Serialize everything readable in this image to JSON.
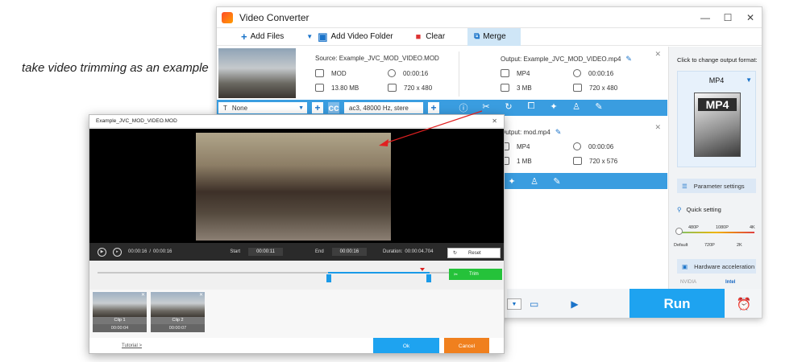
{
  "caption": "take video trimming as an example",
  "window": {
    "title": "Video Converter",
    "minimize_label": "—",
    "maximize_label": "☐",
    "close_label": "✕"
  },
  "toolbar": {
    "add_files": "Add Files",
    "add_video_folder": "Add Video Folder",
    "clear": "Clear",
    "merge": "Merge"
  },
  "file1": {
    "source": "Source: Example_JVC_MOD_VIDEO.MOD",
    "src_format": "MOD",
    "src_duration": "00:00:16",
    "src_size": "13.80 MB",
    "src_resolution": "720 x 480",
    "output": "Output: Example_JVC_MOD_VIDEO.mp4",
    "out_format": "MP4",
    "out_duration": "00:00:16",
    "out_size": "3 MB",
    "out_resolution": "720 x 480",
    "subtitle": "None",
    "audio": "ac3, 48000 Hz, stere"
  },
  "file2": {
    "output": "Output: mod.mp4",
    "out_format": "MP4",
    "out_duration": "00:00:06",
    "out_size": "1 MB",
    "out_resolution": "720 x 576"
  },
  "right_panel": {
    "change_format": "Click to change output format:",
    "format": "MP4",
    "format_icon_text": "MP4",
    "parameter_settings": "Parameter settings",
    "quick_setting": "Quick setting",
    "ticks_top": [
      "480P",
      "1080P",
      "4K"
    ],
    "ticks_bottom": [
      "Default",
      "720P",
      "2K"
    ],
    "hardware_acceleration": "Hardware acceleration",
    "nvidia": "NVIDIA",
    "intel": "Intel"
  },
  "run_label": "Run",
  "dialog": {
    "title": "Example_JVC_MOD_VIDEO.MOD",
    "current_time": "00:00:16",
    "separator": "/",
    "total_time": "00:00:16",
    "start_label": "Start",
    "start_value": "00:00:11",
    "end_label": "End",
    "end_value": "00:00:16",
    "duration_label": "Duration:",
    "duration_value": "00:00:04.704",
    "reset": "Reset",
    "trim": "Trim",
    "clips": [
      {
        "name": "Clip 1",
        "duration": "00:00:04"
      },
      {
        "name": "Clip 2",
        "duration": "00:00:07"
      }
    ],
    "tutorial": "Tutorial >",
    "ok": "Ok",
    "cancel": "Cancel"
  },
  "colors": {
    "accent_blue": "#3a9de0",
    "run_blue": "#1ea3f0",
    "trim_green": "#25c23a",
    "cancel_orange": "#f0801e",
    "arrow_red": "#e02020"
  }
}
